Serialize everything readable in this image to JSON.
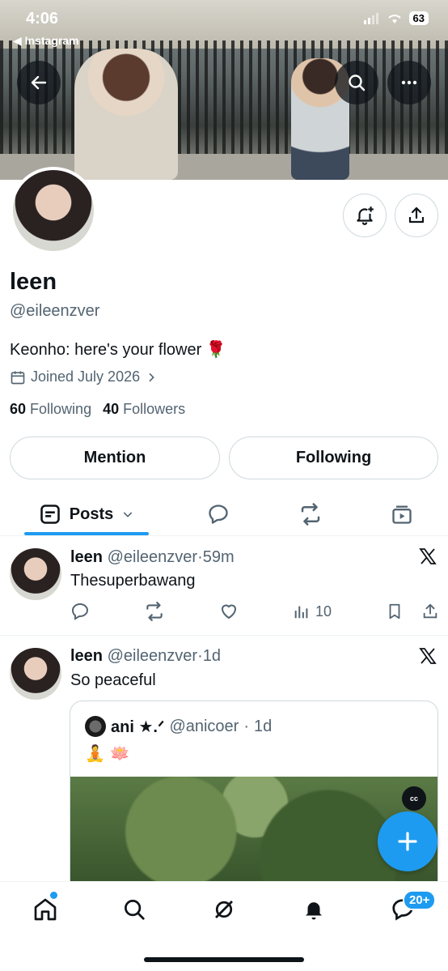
{
  "status": {
    "time": "4:06",
    "back_app": "◀ Instagram",
    "battery": "63"
  },
  "profile": {
    "name": "leen",
    "handle": "@eileenzver",
    "bio": "Keonho: here's your flower 🌹",
    "joined": "Joined July 2026",
    "following_count": "60",
    "following_label": "Following",
    "followers_count": "40",
    "followers_label": "Followers"
  },
  "buttons": {
    "mention": "Mention",
    "following": "Following"
  },
  "tabs": {
    "posts": "Posts"
  },
  "posts": [
    {
      "name": "leen",
      "handle": "@eileenzver",
      "dot": "·",
      "time": "59m",
      "text": "Thesuperbawang",
      "views": "10"
    },
    {
      "name": "leen",
      "handle": "@eileenzver",
      "dot": "·",
      "time": "1d",
      "text": "So peaceful",
      "quote": {
        "name": "ani ★.ᐟ",
        "handle": "@anicoer",
        "dot": "·",
        "time": "1d",
        "text": "🧘 🪷"
      }
    }
  ],
  "media": {
    "cc": "cc"
  },
  "nav": {
    "badge": "20+"
  },
  "colors": {
    "accent": "#1d9bf0",
    "text": "#0f1419",
    "muted": "#536471"
  }
}
